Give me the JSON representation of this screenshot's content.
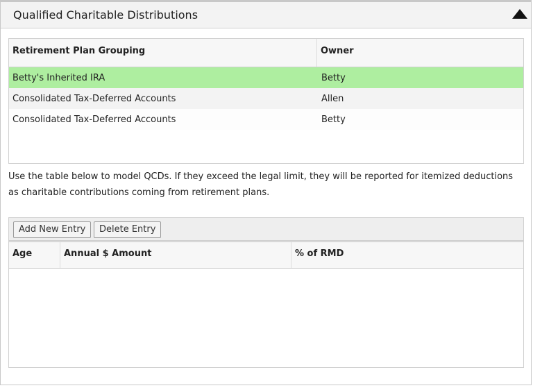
{
  "panel": {
    "title": "Qualified Charitable Distributions",
    "collapse_icon": "triangle-up-icon"
  },
  "plans_table": {
    "columns": [
      "Retirement Plan Grouping",
      "Owner"
    ],
    "rows": [
      {
        "grouping": "Betty's Inherited IRA",
        "owner": "Betty",
        "selected": true
      },
      {
        "grouping": "Consolidated Tax-Deferred Accounts",
        "owner": "Allen",
        "selected": false
      },
      {
        "grouping": "Consolidated Tax-Deferred Accounts",
        "owner": "Betty",
        "selected": false
      }
    ],
    "selected_color": "#aeeea0"
  },
  "description": "Use the table below to model QCDs. If they exceed the legal limit, they will be reported for itemized deductions as charitable contributions coming from retirement plans.",
  "toolbar": {
    "add_label": "Add New Entry",
    "delete_label": "Delete Entry"
  },
  "qcd_table": {
    "columns": [
      "Age",
      "Annual $ Amount",
      "% of RMD"
    ],
    "rows": []
  }
}
